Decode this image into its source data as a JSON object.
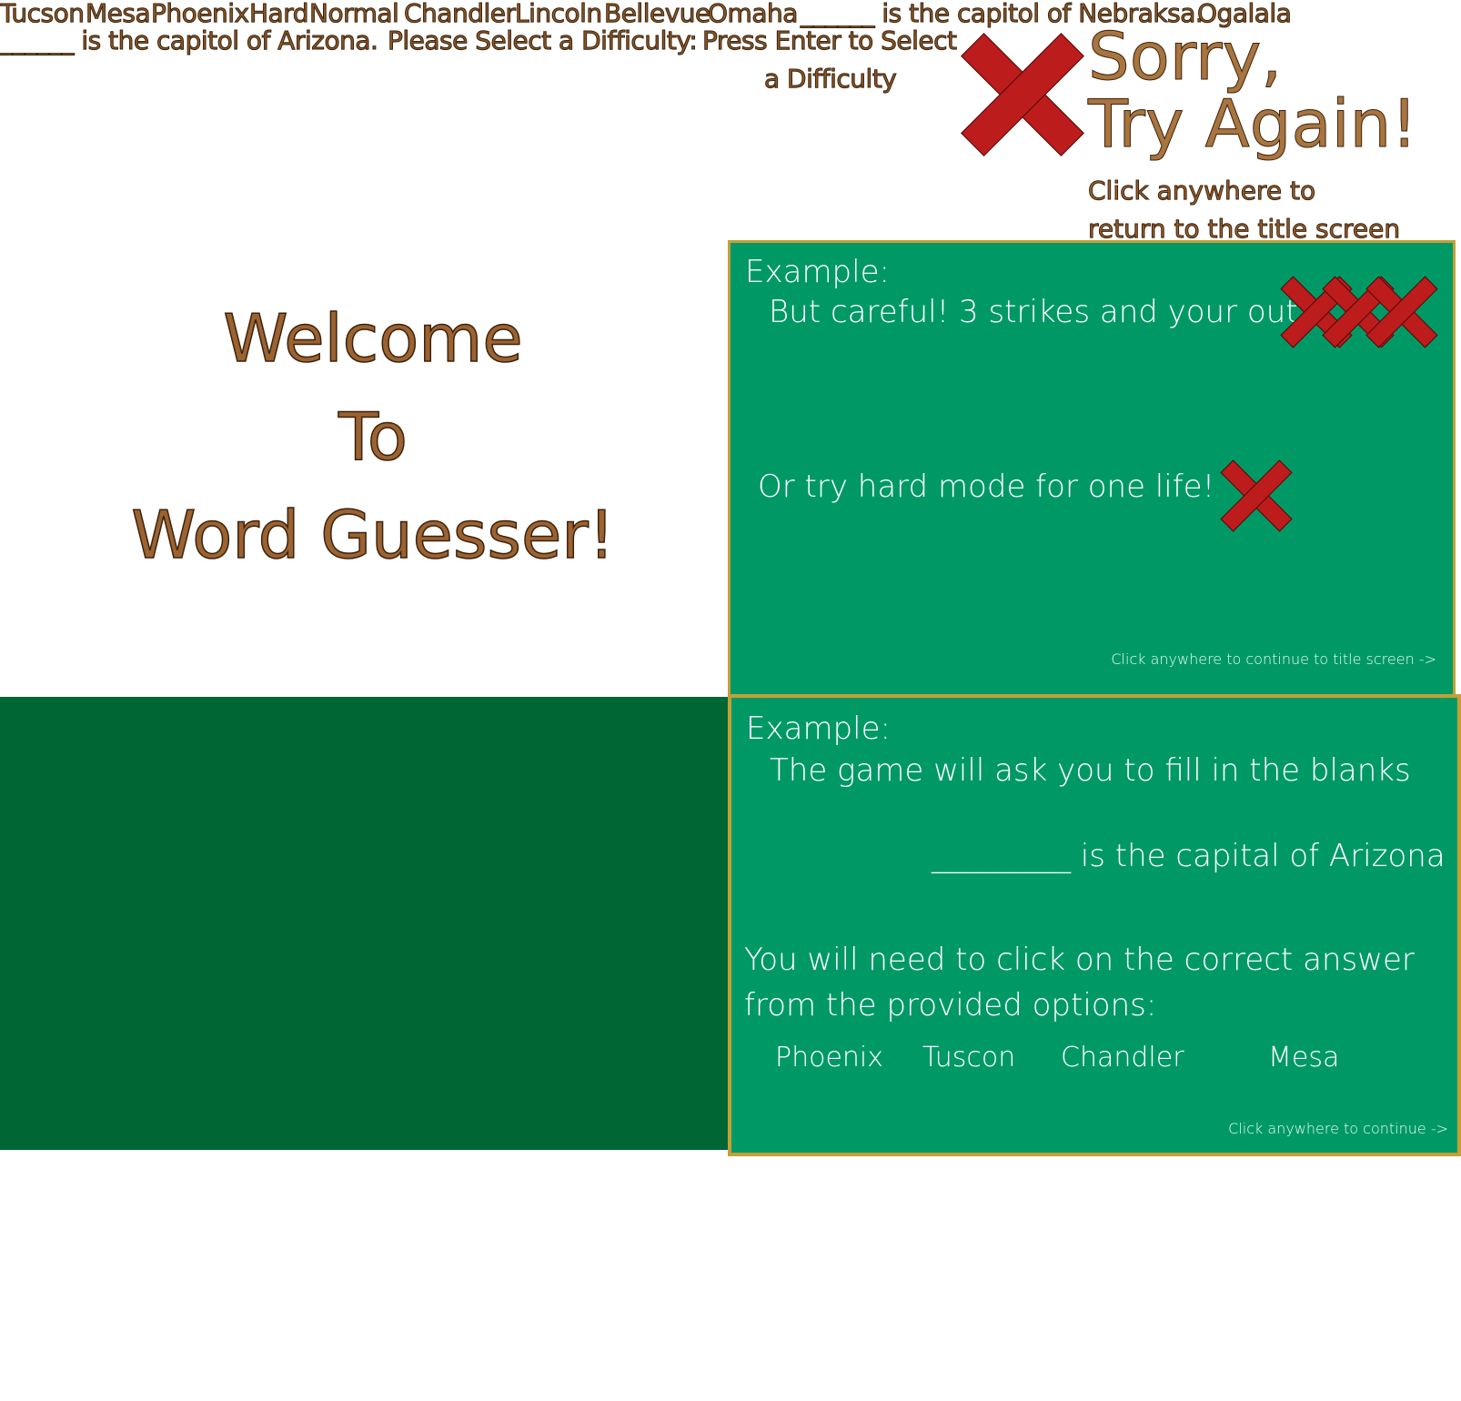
{
  "sprites": {
    "row1": [
      "Tucson",
      "Mesa",
      "Phoenix",
      "Hard",
      "Normal",
      "Chandler",
      "Lincoln",
      "Bellevue",
      "Omaha",
      "______ is the capitol of Nebraksa.",
      "Ogalala"
    ],
    "row2": [
      "______ is the capitol of Arizona.",
      "Please Select a Difficulty:",
      "Press Enter to Select",
      "a Difficulty"
    ]
  },
  "game_over": {
    "title_line1": "Sorry,",
    "title_line2": "Try Again!",
    "hint_line1": "Click anywhere to",
    "hint_line2": "return to the title screen"
  },
  "welcome": {
    "line1": "Welcome",
    "line2": "To",
    "line3": "Word Guesser!"
  },
  "strikes_panel": {
    "heading": "Example:",
    "line1": "But careful! 3 strikes and your out!",
    "line2": "Or try hard mode for one life!",
    "continue": "Click anywhere to continue to title screen ->"
  },
  "example_panel": {
    "heading": "Example:",
    "line1": "The game will ask you to fill in the blanks",
    "question": "_________ is the capital of Arizona",
    "instruction1": "You will need to click on the correct answer",
    "instruction2": "from the provided options:",
    "options": [
      "Phoenix",
      "Tuscon",
      "Chandler",
      "Mesa"
    ],
    "continue": "Click anywhere to continue ->"
  },
  "colors": {
    "panel_green": "#009966",
    "dark_green": "#006633",
    "gold_border": "#c4a037",
    "strike_red": "#bd1c1c",
    "text_brown": "#9b6232"
  }
}
